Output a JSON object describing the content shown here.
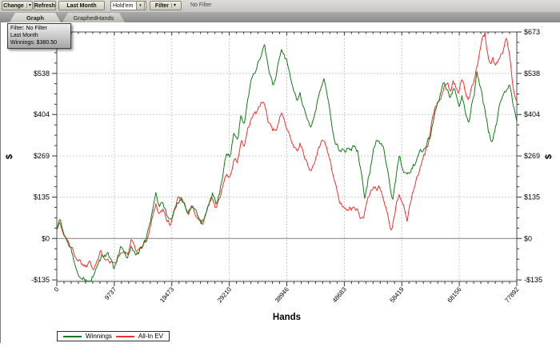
{
  "toolbar": {
    "change_label": "Change",
    "refresh_label": "Refresh",
    "last_month_label": "Last Month",
    "game_select_value": "Hold'em",
    "filter_label": "Filter",
    "filter_status": "No Filter"
  },
  "icons": {
    "dropdown": "▾"
  },
  "tabs": {
    "graph": "Graph",
    "graphed_hands": "GraphedHands"
  },
  "info_box": {
    "filter_line": "Filter: No Filter",
    "period_line": "Last Month",
    "winnings_line": "Winnings: $380.50"
  },
  "chart_data": {
    "type": "line",
    "title": "",
    "xlabel": "Hands",
    "ylabel_left": "$",
    "ylabel_right": "$",
    "xlim": [
      0,
      77892
    ],
    "ylim": [
      -140,
      673
    ],
    "grid": "dotted",
    "zero_line": true,
    "legend_position": "bottom",
    "x_ticks": [
      {
        "v": 0,
        "label": "0"
      },
      {
        "v": 9737,
        "label": "9737"
      },
      {
        "v": 19473,
        "label": "19473"
      },
      {
        "v": 29210,
        "label": "29210"
      },
      {
        "v": 38946,
        "label": "38946"
      },
      {
        "v": 48683,
        "label": "48683"
      },
      {
        "v": 58419,
        "label": "58419"
      },
      {
        "v": 68156,
        "label": "68156"
      },
      {
        "v": 77892,
        "label": "77892"
      }
    ],
    "y_ticks": [
      {
        "v": -135,
        "label": "-$135"
      },
      {
        "v": 0,
        "label": "$0"
      },
      {
        "v": 135,
        "label": "$135"
      },
      {
        "v": 269,
        "label": "$269"
      },
      {
        "v": 404,
        "label": "$404"
      },
      {
        "v": 538,
        "label": "$538"
      },
      {
        "v": 673,
        "label": "$673"
      }
    ],
    "x_minor_subdivisions": 8,
    "y_minor_subdivisions": 4,
    "series": [
      {
        "name": "Winnings",
        "color": "#157a19",
        "final_value": 380.5,
        "points": [
          [
            0,
            30
          ],
          [
            500,
            62
          ],
          [
            1200,
            20
          ],
          [
            2000,
            -25
          ],
          [
            2800,
            -70
          ],
          [
            3600,
            -95
          ],
          [
            4300,
            -120
          ],
          [
            5000,
            -132
          ],
          [
            5600,
            -145
          ],
          [
            6200,
            -118
          ],
          [
            6800,
            -95
          ],
          [
            7400,
            -78
          ],
          [
            8000,
            -65
          ],
          [
            8700,
            -58
          ],
          [
            9200,
            -85
          ],
          [
            9700,
            -112
          ],
          [
            10300,
            -80
          ],
          [
            10800,
            -48
          ],
          [
            11400,
            -62
          ],
          [
            12000,
            -70
          ],
          [
            12600,
            -28
          ],
          [
            13200,
            -45
          ],
          [
            13800,
            -52
          ],
          [
            14400,
            -30
          ],
          [
            15000,
            -5
          ],
          [
            15600,
            25
          ],
          [
            16200,
            85
          ],
          [
            16800,
            128
          ],
          [
            17400,
            100
          ],
          [
            18000,
            112
          ],
          [
            18600,
            75
          ],
          [
            19200,
            60
          ],
          [
            19800,
            95
          ],
          [
            20400,
            135
          ],
          [
            21000,
            148
          ],
          [
            21600,
            130
          ],
          [
            22200,
            100
          ],
          [
            22800,
            128
          ],
          [
            23400,
            105
          ],
          [
            24000,
            82
          ],
          [
            24600,
            58
          ],
          [
            25200,
            80
          ],
          [
            25800,
            125
          ],
          [
            26400,
            148
          ],
          [
            27000,
            125
          ],
          [
            27600,
            160
          ],
          [
            28200,
            230
          ],
          [
            28800,
            280
          ],
          [
            29400,
            260
          ],
          [
            30000,
            330
          ],
          [
            30600,
            310
          ],
          [
            31200,
            400
          ],
          [
            31800,
            370
          ],
          [
            32400,
            450
          ],
          [
            33000,
            520
          ],
          [
            33700,
            560
          ],
          [
            34300,
            595
          ],
          [
            34800,
            618
          ],
          [
            35200,
            632
          ],
          [
            35600,
            585
          ],
          [
            36000,
            548
          ],
          [
            36600,
            492
          ],
          [
            37200,
            532
          ],
          [
            37600,
            582
          ],
          [
            38000,
            615
          ],
          [
            38400,
            592
          ],
          [
            39000,
            560
          ],
          [
            39800,
            505
          ],
          [
            40600,
            452
          ],
          [
            41200,
            472
          ],
          [
            41800,
            425
          ],
          [
            42400,
            392
          ],
          [
            43000,
            362
          ],
          [
            43800,
            420
          ],
          [
            44600,
            490
          ],
          [
            45300,
            532
          ],
          [
            45800,
            482
          ],
          [
            46300,
            420
          ],
          [
            47000,
            332
          ],
          [
            47800,
            300
          ],
          [
            48600,
            312
          ],
          [
            49400,
            298
          ],
          [
            50200,
            305
          ],
          [
            51000,
            282
          ],
          [
            51600,
            205
          ],
          [
            52100,
            128
          ],
          [
            52700,
            195
          ],
          [
            53300,
            255
          ],
          [
            53900,
            312
          ],
          [
            54600,
            330
          ],
          [
            55300,
            295
          ],
          [
            56000,
            222
          ],
          [
            56900,
            118
          ],
          [
            57500,
            195
          ],
          [
            58000,
            275
          ],
          [
            58500,
            235
          ],
          [
            59100,
            210
          ],
          [
            59600,
            200
          ],
          [
            60200,
            235
          ],
          [
            60800,
            252
          ],
          [
            61500,
            270
          ],
          [
            62300,
            292
          ],
          [
            63200,
            328
          ],
          [
            63800,
            390
          ],
          [
            64400,
            430
          ],
          [
            65000,
            470
          ],
          [
            65600,
            498
          ],
          [
            66100,
            478
          ],
          [
            66600,
            458
          ],
          [
            67100,
            488
          ],
          [
            67600,
            468
          ],
          [
            68100,
            442
          ],
          [
            68600,
            468
          ],
          [
            69100,
            420
          ],
          [
            69700,
            378
          ],
          [
            70200,
            430
          ],
          [
            70700,
            462
          ],
          [
            71100,
            545
          ],
          [
            71500,
            510
          ],
          [
            72000,
            478
          ],
          [
            72500,
            420
          ],
          [
            73100,
            345
          ],
          [
            73700,
            310
          ],
          [
            74200,
            345
          ],
          [
            74700,
            392
          ],
          [
            75200,
            438
          ],
          [
            75700,
            468
          ],
          [
            76200,
            492
          ],
          [
            76700,
            512
          ],
          [
            77000,
            478
          ],
          [
            77300,
            442
          ],
          [
            77600,
            415
          ],
          [
            77892,
            380.5
          ]
        ]
      },
      {
        "name": "All-In EV",
        "color": "#ec3232",
        "final_value": 445,
        "points": [
          [
            0,
            28
          ],
          [
            500,
            55
          ],
          [
            1200,
            10
          ],
          [
            2000,
            -15
          ],
          [
            2800,
            -45
          ],
          [
            3600,
            -62
          ],
          [
            4300,
            -75
          ],
          [
            5000,
            -85
          ],
          [
            5600,
            -62
          ],
          [
            6200,
            -80
          ],
          [
            6800,
            -58
          ],
          [
            7400,
            -45
          ],
          [
            8000,
            -52
          ],
          [
            8700,
            -45
          ],
          [
            9200,
            -58
          ],
          [
            9700,
            -72
          ],
          [
            10300,
            -52
          ],
          [
            10800,
            -35
          ],
          [
            11400,
            -48
          ],
          [
            12000,
            -55
          ],
          [
            12600,
            -20
          ],
          [
            13200,
            -35
          ],
          [
            13800,
            -42
          ],
          [
            14400,
            -25
          ],
          [
            15000,
            -8
          ],
          [
            15600,
            18
          ],
          [
            16200,
            70
          ],
          [
            16800,
            115
          ],
          [
            17400,
            88
          ],
          [
            18000,
            100
          ],
          [
            18600,
            62
          ],
          [
            19200,
            50
          ],
          [
            19800,
            82
          ],
          [
            20400,
            120
          ],
          [
            21000,
            135
          ],
          [
            21600,
            118
          ],
          [
            22200,
            88
          ],
          [
            22800,
            115
          ],
          [
            23400,
            92
          ],
          [
            24000,
            70
          ],
          [
            24600,
            48
          ],
          [
            25200,
            68
          ],
          [
            25800,
            110
          ],
          [
            26400,
            132
          ],
          [
            27000,
            108
          ],
          [
            27600,
            135
          ],
          [
            28200,
            185
          ],
          [
            28800,
            225
          ],
          [
            29400,
            205
          ],
          [
            30000,
            262
          ],
          [
            30600,
            248
          ],
          [
            31200,
            318
          ],
          [
            31800,
            295
          ],
          [
            32400,
            345
          ],
          [
            33000,
            385
          ],
          [
            33700,
            402
          ],
          [
            34300,
            420
          ],
          [
            34800,
            438
          ],
          [
            35200,
            428
          ],
          [
            35600,
            395
          ],
          [
            36000,
            372
          ],
          [
            36600,
            335
          ],
          [
            37200,
            355
          ],
          [
            37600,
            382
          ],
          [
            38000,
            402
          ],
          [
            38400,
            388
          ],
          [
            39000,
            372
          ],
          [
            39800,
            328
          ],
          [
            40600,
            292
          ],
          [
            41200,
            310
          ],
          [
            41800,
            272
          ],
          [
            42400,
            245
          ],
          [
            43000,
            215
          ],
          [
            43800,
            262
          ],
          [
            44600,
            302
          ],
          [
            45300,
            330
          ],
          [
            45800,
            295
          ],
          [
            46300,
            272
          ],
          [
            47000,
            182
          ],
          [
            47800,
            125
          ],
          [
            48600,
            98
          ],
          [
            49400,
            112
          ],
          [
            50200,
            100
          ],
          [
            51000,
            88
          ],
          [
            51900,
            66
          ],
          [
            52700,
            138
          ],
          [
            53300,
            162
          ],
          [
            53900,
            182
          ],
          [
            54600,
            172
          ],
          [
            55300,
            142
          ],
          [
            56000,
            92
          ],
          [
            56600,
            25
          ],
          [
            57300,
            92
          ],
          [
            58000,
            148
          ],
          [
            58500,
            112
          ],
          [
            59300,
            62
          ],
          [
            60000,
            122
          ],
          [
            60800,
            182
          ],
          [
            61500,
            222
          ],
          [
            62300,
            262
          ],
          [
            63200,
            325
          ],
          [
            63800,
            390
          ],
          [
            64400,
            432
          ],
          [
            65000,
            468
          ],
          [
            65600,
            505
          ],
          [
            66100,
            528
          ],
          [
            66600,
            495
          ],
          [
            67100,
            522
          ],
          [
            67600,
            502
          ],
          [
            68100,
            478
          ],
          [
            68600,
            512
          ],
          [
            69100,
            472
          ],
          [
            69700,
            442
          ],
          [
            70200,
            492
          ],
          [
            70700,
            532
          ],
          [
            71200,
            572
          ],
          [
            71700,
            615
          ],
          [
            72200,
            648
          ],
          [
            72500,
            660
          ],
          [
            72900,
            612
          ],
          [
            73300,
            575
          ],
          [
            73800,
            592
          ],
          [
            74300,
            565
          ],
          [
            74800,
            585
          ],
          [
            75300,
            605
          ],
          [
            75800,
            625
          ],
          [
            76200,
            645
          ],
          [
            76600,
            612
          ],
          [
            76900,
            558
          ],
          [
            77200,
            502
          ],
          [
            77500,
            468
          ],
          [
            77892,
            445
          ]
        ]
      }
    ]
  }
}
